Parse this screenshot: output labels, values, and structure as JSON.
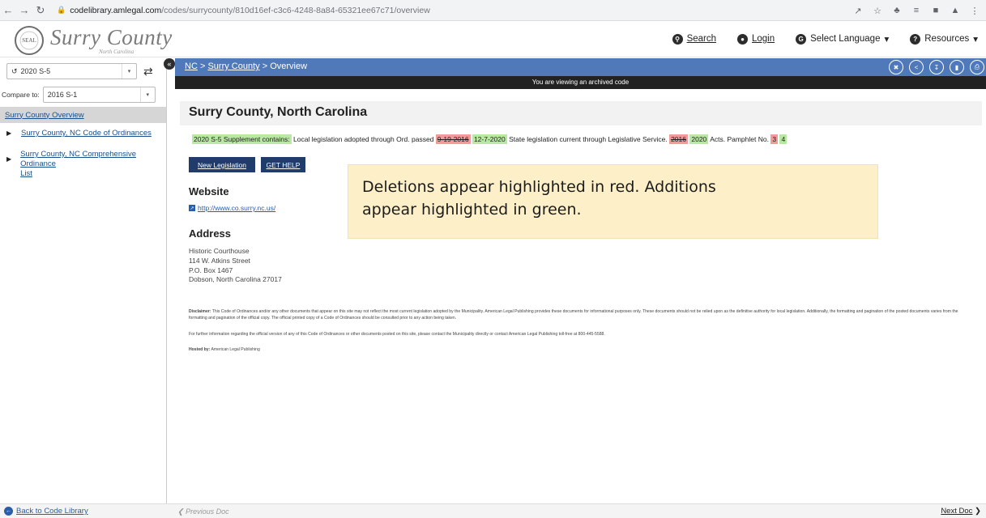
{
  "browser": {
    "url_domain": "codelibrary.amlegal.com",
    "url_path": "/codes/surrycounty/810d16ef-c3c6-4248-8a84-65321ee67c71/overview"
  },
  "site": {
    "logo_title": "Surry County",
    "logo_subtitle": "North Carolina",
    "links": {
      "search": "Search",
      "login": "Login",
      "language": "Select Language",
      "resources": "Resources"
    }
  },
  "sidebar": {
    "version": "2020 S-5",
    "compare_label": "Compare to:",
    "compare_value": "2016 S-1",
    "active_item": "Surry County Overview",
    "items": [
      {
        "label": "Surry County, NC Code of Ordinances"
      },
      {
        "label": "Surry County, NC Comprehensive Ordinance"
      },
      {
        "label": "List"
      }
    ]
  },
  "main": {
    "breadcrumb": {
      "nc": "NC",
      "county": "Surry County",
      "sep": ">",
      "current": "Overview"
    },
    "archived_notice": "You are viewing an archived code",
    "title": "Surry County, North Carolina",
    "supplement": {
      "contains": "2020 S-5 Supplement contains:",
      "text1": "Local legislation adopted through Ord. passed",
      "deleted_date": "9-19-2016",
      "added_date": "12-7-2020",
      "text2": "State legislation current through Legislative Service.",
      "deleted_year": "2016",
      "added_year": "2020",
      "text3": "Acts. Pamphlet No.",
      "deleted_no": "3",
      "added_no": "4"
    },
    "buttons": {
      "new_legislation": "New Legislation",
      "get_help": "GET HELP"
    },
    "website_heading": "Website",
    "website_url": "http://www.co.surry.nc.us/",
    "address_heading": "Address",
    "address": [
      "Historic Courthouse",
      "114 W. Atkins Street",
      "P.O. Box 1467",
      "Dobson, North Carolina 27017"
    ],
    "disclaimer_label": "Disclaimer:",
    "disclaimer_text": "This Code of Ordinances and/or any other documents that appear on this site may not reflect the most current legislation adopted by the Municipality. American Legal Publishing provides these documents for informational purposes only. These documents should not be relied upon as the definitive authority for local legislation. Additionally, the formatting and pagination of the posted documents varies from the formatting and pagination of the official copy. The official printed copy of a Code of Ordinances should be consulted prior to any action being taken.",
    "further_info": "For further information regarding the official version of any of this Code of Ordinances or other documents posted on this site, please contact the Municipality directly or contact American Legal Publishing toll-free at 800-445-5588.",
    "hosted_label": "Hosted by:",
    "hosted_value": "American Legal Publishing"
  },
  "callout": {
    "line1": "Deletions appear highlighted in red.  Additions",
    "line2": "appear highlighted in green."
  },
  "footer": {
    "back": "Back to Code Library",
    "prev": "Previous Doc",
    "next": "Next Doc"
  },
  "colors": {
    "bluebar": "#4f79b8",
    "addition_highlight": "#b9e8a2",
    "deletion_highlight": "#f39a9a",
    "callout_bg": "#fdf0c9",
    "button_dark": "#1f3c6b"
  }
}
